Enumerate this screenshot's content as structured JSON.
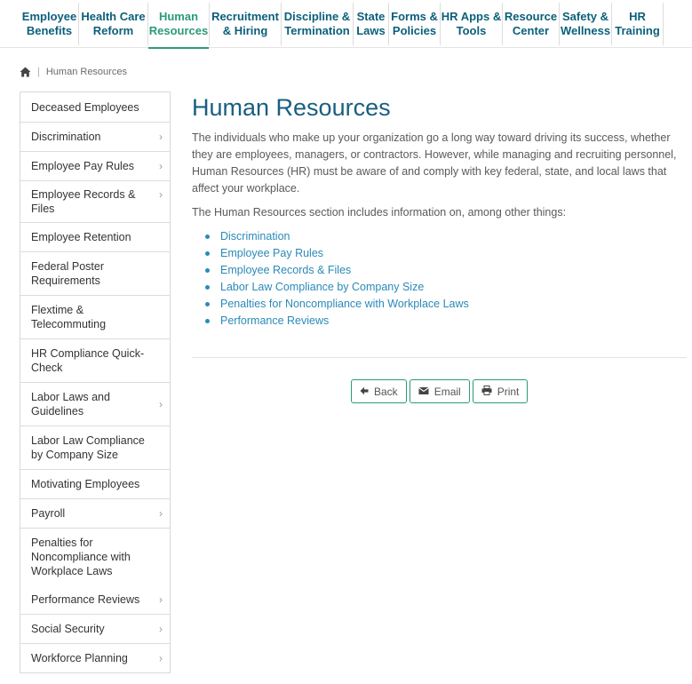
{
  "nav": {
    "tabs": [
      {
        "label": "Employee\nBenefits",
        "active": false
      },
      {
        "label": "Health Care\nReform",
        "active": false
      },
      {
        "label": "Human\nResources",
        "active": true
      },
      {
        "label": "Recruitment\n& Hiring",
        "active": false
      },
      {
        "label": "Discipline &\nTermination",
        "active": false
      },
      {
        "label": "State\nLaws",
        "active": false
      },
      {
        "label": "Forms &\nPolicies",
        "active": false
      },
      {
        "label": "HR Apps &\nTools",
        "active": false
      },
      {
        "label": "Resource\nCenter",
        "active": false
      },
      {
        "label": "Safety &\nWellness",
        "active": false
      },
      {
        "label": "HR\nTraining",
        "active": false
      }
    ],
    "active_color": "#2a9a7a",
    "link_color": "#0b5f7a"
  },
  "breadcrumb": {
    "home_icon": "home-icon",
    "separator": "|",
    "current": "Human Resources"
  },
  "sidebar": {
    "items": [
      {
        "label": "Deceased Employees",
        "has_children": false
      },
      {
        "label": "Discrimination",
        "has_children": true
      },
      {
        "label": "Employee Pay Rules",
        "has_children": true
      },
      {
        "label": "Employee Records & Files",
        "has_children": true
      },
      {
        "label": "Employee Retention",
        "has_children": false
      },
      {
        "label": "Federal Poster Requirements",
        "has_children": false
      },
      {
        "label": "Flextime & Telecommuting",
        "has_children": false
      },
      {
        "label": "HR Compliance Quick-Check",
        "has_children": false
      },
      {
        "label": "Labor Laws and Guidelines",
        "has_children": true
      },
      {
        "label": "Labor Law Compliance by Company Size",
        "has_children": false
      },
      {
        "label": "Motivating Employees",
        "has_children": false
      },
      {
        "label": "Payroll",
        "has_children": true
      },
      {
        "label": "Penalties for Noncompliance with Workplace Laws",
        "has_children": false
      },
      {
        "label": "Performance Reviews",
        "has_children": true
      },
      {
        "label": "Social Security",
        "has_children": true
      },
      {
        "label": "Workforce Planning",
        "has_children": true
      }
    ],
    "chevron": "›"
  },
  "main": {
    "title": "Human Resources",
    "intro": "The individuals who make up your organization go a long way toward driving its success, whether they are employees, managers, or contractors. However, while managing and recruiting personnel, Human Resources (HR) must be aware of and comply with key federal, state, and local laws that affect your workplace.",
    "lead": "The Human Resources section includes information on, among other things:",
    "links": [
      "Discrimination",
      "Employee Pay Rules",
      "Employee Records & Files",
      "Labor Law Compliance by Company Size",
      "Penalties for Noncompliance with Workplace Laws",
      "Performance Reviews"
    ],
    "title_color": "#1a5e80",
    "link_color": "#2a8ab8"
  },
  "actions": {
    "back_label": "Back",
    "email_label": "Email",
    "print_label": "Print",
    "back_icon": "arrow-left-icon",
    "email_icon": "envelope-icon",
    "print_icon": "printer-icon",
    "border_color": "#2a9a7a"
  }
}
